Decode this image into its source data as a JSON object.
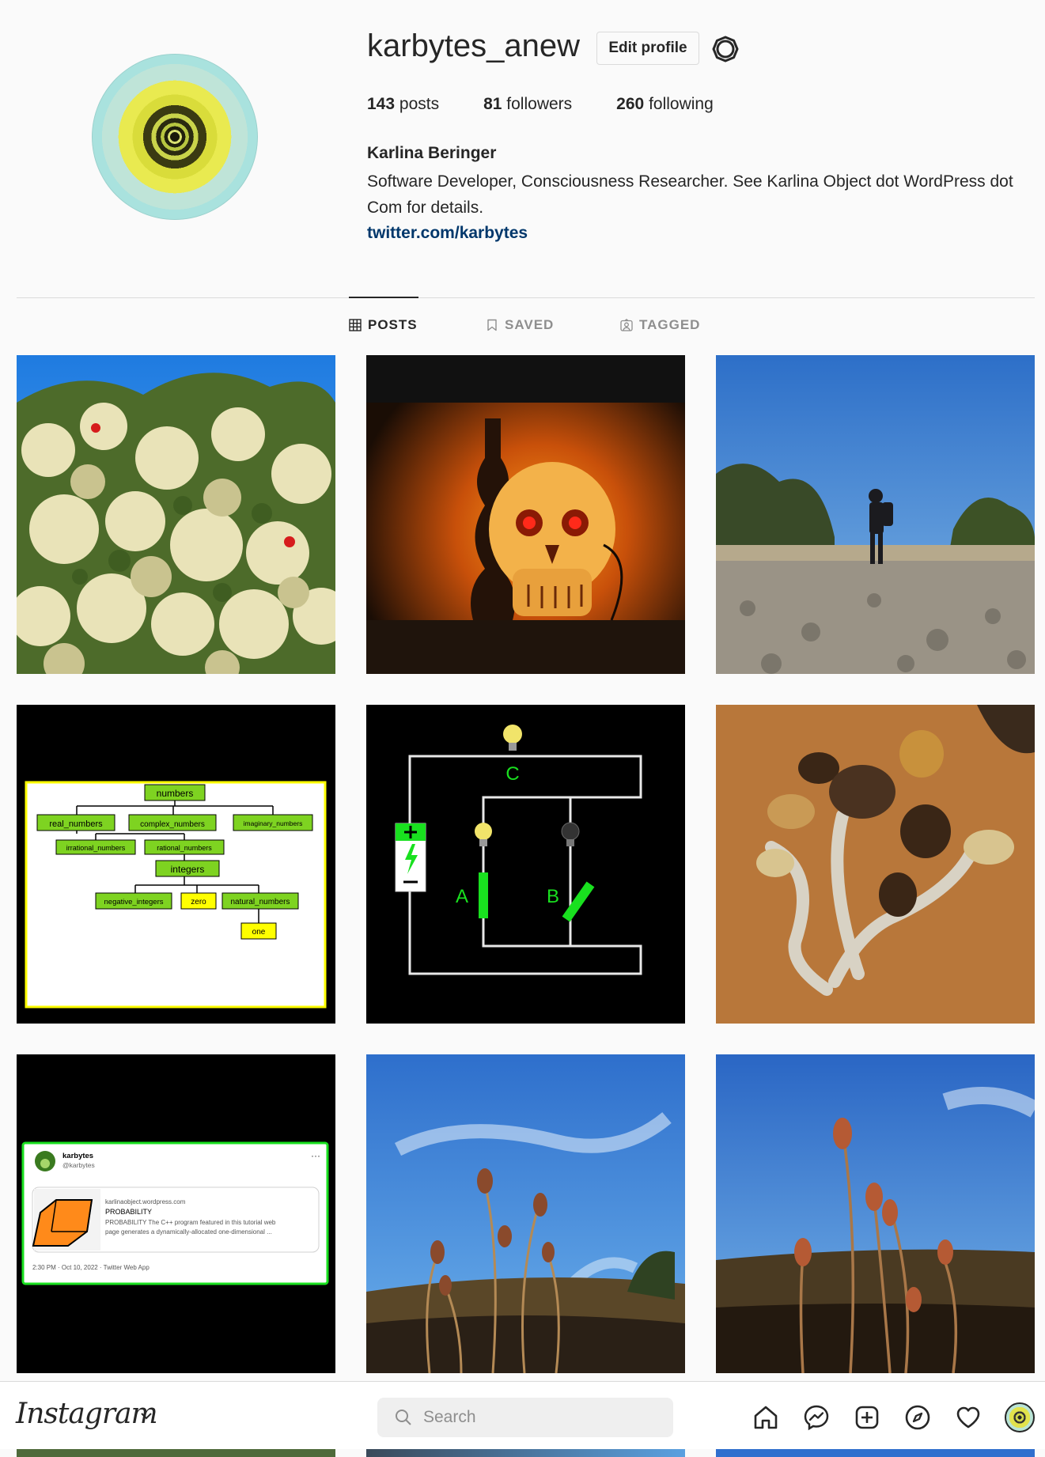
{
  "profile": {
    "username": "karbytes_anew",
    "edit_label": "Edit profile",
    "full_name": "Karlina Beringer",
    "bio": "Software Developer, Consciousness Researcher. See Karlina Object dot WordPress dot Com for details.",
    "link": "twitter.com/karbytes",
    "stats": {
      "posts_count": "143",
      "posts_label": "posts",
      "followers_count": "81",
      "followers_label": "followers",
      "following_count": "260",
      "following_label": "following"
    }
  },
  "tabs": [
    {
      "label": "POSTS",
      "icon": "grid-icon",
      "active": true
    },
    {
      "label": "SAVED",
      "icon": "bookmark-icon",
      "active": false
    },
    {
      "label": "TAGGED",
      "icon": "tagged-user-icon",
      "active": false
    }
  ],
  "posts": {
    "tree": {
      "numbers": "numbers",
      "real": "real_numbers",
      "complex": "complex_numbers",
      "imaginary": "imaginary_numbers",
      "irrational": "irrational_numbers",
      "rational": "rational_numbers",
      "integers": "integers",
      "negative": "negative_integers",
      "zero": "zero",
      "natural": "natural_numbers",
      "one": "one"
    },
    "circuit": {
      "label_a": "A",
      "label_b": "B",
      "label_c": "C"
    },
    "tweet": {
      "name": "karbytes",
      "handle": "@karbytes",
      "domain": "karlinaobject.wordpress.com",
      "card_title": "PROBABILITY",
      "card_desc_1": "PROBABILITY The C++ program featured in this tutorial web",
      "card_desc_2": "page generates a dynamically-allocated one-dimensional ...",
      "meta": "2:30 PM · Oct 10, 2022 · Twitter Web App"
    }
  },
  "bottom_bar": {
    "logo": "Instagram",
    "search_placeholder": "Search",
    "nav": [
      "home-icon",
      "messenger-icon",
      "new-post-icon",
      "explore-icon",
      "activity-heart-icon",
      "profile-avatar"
    ]
  },
  "colors": {
    "link": "#00376b",
    "border": "#dbdbdb",
    "text": "#262626",
    "muted": "#8e8e8e",
    "tree_node": "#7ed321",
    "tree_leaf": "#ffff00",
    "circuit_green": "#19e01f"
  }
}
